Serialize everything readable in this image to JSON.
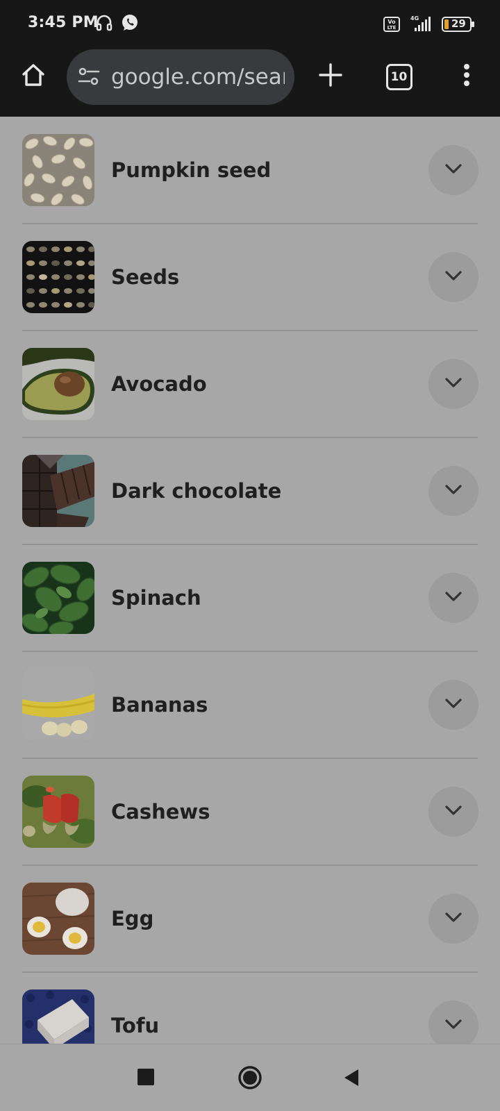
{
  "status_bar": {
    "time": "3:45 PM",
    "battery_level": "29",
    "network_label": "4G",
    "volte_label": "Vo LTE",
    "icons": [
      "headset-icon",
      "whatsapp-icon",
      "volte-icon",
      "signal-icon",
      "battery-icon"
    ]
  },
  "toolbar": {
    "url": "google.com/search",
    "tab_count": "10",
    "icons": [
      "home-icon",
      "site-settings-icon",
      "new-tab-icon",
      "tab-switcher-icon",
      "more-icon"
    ]
  },
  "list": {
    "items": [
      {
        "label": "Pumpkin seed",
        "thumb": "pumpkin-seed-image"
      },
      {
        "label": "Seeds",
        "thumb": "seeds-image"
      },
      {
        "label": "Avocado",
        "thumb": "avocado-image"
      },
      {
        "label": "Dark chocolate",
        "thumb": "dark-chocolate-image"
      },
      {
        "label": "Spinach",
        "thumb": "spinach-image"
      },
      {
        "label": "Bananas",
        "thumb": "bananas-image"
      },
      {
        "label": "Cashews",
        "thumb": "cashews-image"
      },
      {
        "label": "Egg",
        "thumb": "egg-image"
      },
      {
        "label": "Tofu",
        "thumb": "tofu-image"
      }
    ],
    "expand_icon": "chevron-down-icon"
  },
  "nav_bar": {
    "icons": [
      "recents-square-icon",
      "home-circle-icon",
      "back-triangle-icon"
    ]
  },
  "colors": {
    "status_bg": "#171717",
    "url_pill_bg": "#383a3d",
    "content_bg": "#a7a7a7",
    "chevron_bg": "#9c9c9c",
    "text": "#1f1f1f"
  }
}
